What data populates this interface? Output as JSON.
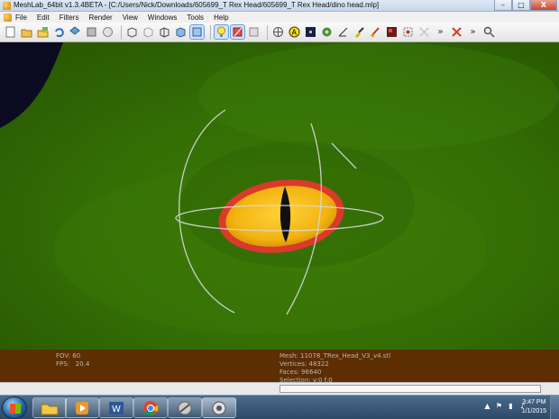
{
  "window": {
    "title": "MeshLab_64bit v1.3.4BETA - [C:/Users/Nick/Downloads/605699_T Rex Head/605699_T Rex Head/dino head.mlp]",
    "minimize": "–",
    "maximize": "□",
    "close": "X"
  },
  "menu": {
    "items": [
      "File",
      "Edit",
      "Filters",
      "Render",
      "View",
      "Windows",
      "Tools",
      "Help"
    ]
  },
  "toolbar": {
    "icons": [
      "new-project-icon",
      "open-project-icon",
      "save-project-icon",
      "reload-icon",
      "import-mesh-icon",
      "export-mesh-icon",
      "snapshot-icon",
      "bounding-box-icon",
      "points-icon",
      "wireframe-icon",
      "hidden-lines-icon",
      "flat-shading-icon",
      "smooth-shading-icon",
      "lighting-icon",
      "backface-icon",
      "color-mode-icon",
      "layers-icon",
      "annotate-icon",
      "texture-icon",
      "measure-icon",
      "align-icon",
      "paint-icon",
      "brush-icon",
      "select-faces-icon",
      "select-vertices-icon",
      "more-icon",
      "delete-selection-icon",
      "more-icon-2",
      "search-icon"
    ],
    "more_label": "»"
  },
  "info": {
    "fov_label": "FOV:",
    "fov_value": "60",
    "fps_label": "FPS:",
    "fps_value": "20.4",
    "mesh": "Mesh: 11078_TRex_Head_V3_v4.stl",
    "vertices": "Vertices: 48322",
    "faces": "Faces: 96640",
    "selection": "Selection: v:0 f:0"
  },
  "taskbar": {
    "time": "3:47 PM",
    "date": "1/1/2015"
  },
  "colors": {
    "viewport_green": "#336d05",
    "eye_yellow": "#f2b410",
    "eye_ring": "#d93a2a",
    "info_panel": "#5c2e02"
  }
}
